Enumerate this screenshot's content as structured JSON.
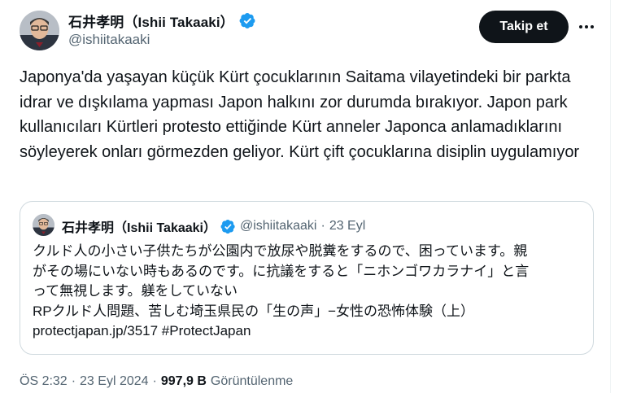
{
  "author": {
    "display_name": "石井孝明（Ishii Takaaki）",
    "handle": "@ishiitakaaki"
  },
  "follow_label": "Takip et",
  "more_icon": "ellipsis-icon",
  "tweet_text": "Japonya'da yaşayan küçük Kürt çocuklarının Saitama vilayetindeki bir parkta idrar ve dışkılama yapması Japon halkını zor durumda bırakıyor. Japon park kullanıcıları Kürtleri protesto ettiğinde Kürt anneler Japonca anlamadıklarını söyleyerek onları görmezden geliyor. Kürt çift çocuklarına disiplin uygulamıyor",
  "quote": {
    "display_name": "石井孝明（Ishii Takaaki）",
    "handle": "@ishiitakaaki",
    "separator": "·",
    "date": "23 Eyl",
    "lines": [
      "クルド人の小さい子供たちが公園内で放尿や脱糞をするので、困っています。親",
      "がその場にいない時もあるのです。に抗議をすると「ニホンゴワカラナイ」と言",
      "って無視します。躾をしていない",
      "RPクルド人問題、苦しむ埼玉県民の「生の声」−女性の恐怖体験（上）",
      "protectjapan.jp/3517 #ProtectJapan"
    ]
  },
  "footer": {
    "time": "ÖS 2:32",
    "separator": "·",
    "date": "23 Eyl 2024",
    "separator2": "·",
    "views_count": "997,9 B",
    "views_label": "Görüntülenme"
  },
  "colors": {
    "verified_blue": "#1d9bf0",
    "text_primary": "#0f1419",
    "text_secondary": "#536471",
    "border": "#cfd9de",
    "button_bg": "#0f1419"
  }
}
